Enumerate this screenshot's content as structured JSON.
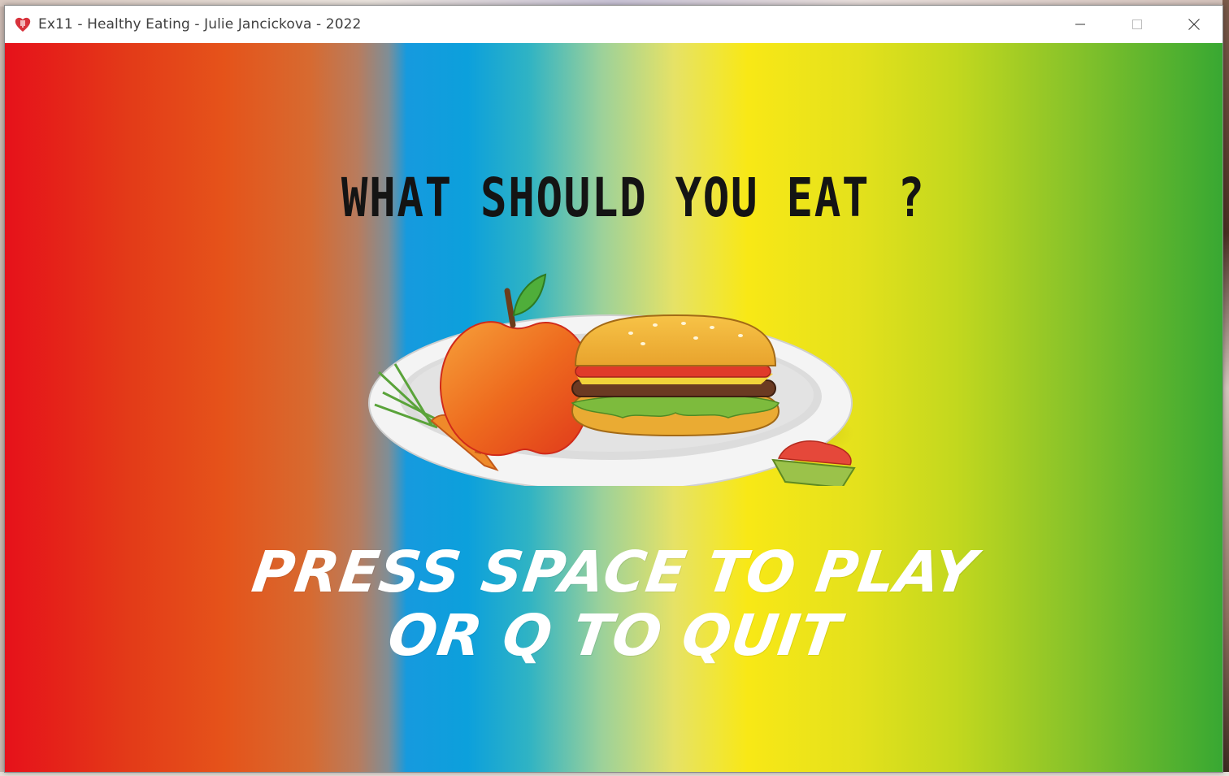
{
  "window": {
    "title": "Ex11 - Healthy Eating - Julie Jancickova - 2022",
    "app_icon": "heart-icon",
    "controls": {
      "minimize_icon": "minimize-icon",
      "maximize_icon": "maximize-icon",
      "close_icon": "close-icon"
    }
  },
  "game": {
    "headline": "WHAT SHOULD YOU EAT ?",
    "illustration": "plate with apple, carrot, burger and ketchup",
    "cta_line1": "PRESS SPACE TO PLAY",
    "cta_line2": "OR Q TO QUIT",
    "background_colors": [
      "#e6111a",
      "#e5531a",
      "#0ca0dc",
      "#f8e816",
      "#38a832"
    ]
  }
}
